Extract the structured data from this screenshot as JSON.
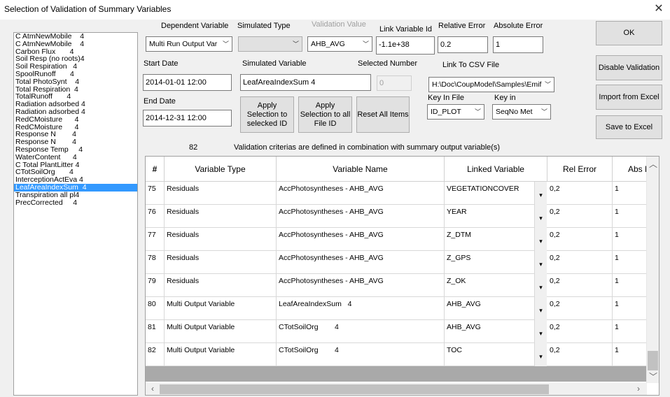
{
  "window": {
    "title": "Selection of Validation of Summary Variables",
    "close_glyph": "✕"
  },
  "list": {
    "items": [
      "C AtmNewMobile    4",
      "C AtmNewMobile    4",
      "Carbon Flux       4",
      "Soil Resp (no roots)4",
      "Soil Respiration   4",
      "SpoolRunoff       4",
      "Total PhotoSynt    4",
      "Total Respiration  4",
      "TotalRunoff       4",
      "Radiation adsorbed 4",
      "Radiation adsorbed 4",
      "RedCMoisture      4",
      "RedCMoisture      4",
      "Response N        4",
      "Response N        4",
      "Response Temp     4",
      "WaterContent      4",
      "C Total PlantLitter 4",
      "CTotSoilOrg       4",
      "InterceptionActEva 4",
      "LeafAreaIndexSum  4",
      "Transpiration all pl4",
      "PrecCorrected     4"
    ],
    "selected_index": 20
  },
  "form": {
    "dependent_variable": {
      "label": "Dependent Variable",
      "value": "Multi Run Output Var"
    },
    "simulated_type": {
      "label": "Simulated Type",
      "value": ""
    },
    "validation_value": {
      "label": "Validation Value",
      "value": "AHB_AVG"
    },
    "link_variable_id": {
      "label": "Link Variable Id",
      "value": "-1.1e+38"
    },
    "relative_error": {
      "label": "Relative Error",
      "value": "0.2"
    },
    "absolute_error": {
      "label": "Absolute Error",
      "value": "1"
    },
    "start_date": {
      "label": "Start Date",
      "value": "2014-01-01 12:00"
    },
    "end_date": {
      "label": "End Date",
      "value": "2014-12-31 12:00"
    },
    "simulated_variable": {
      "label": "Simulated Variable",
      "value": "LeafAreaIndexSum   4"
    },
    "selected_number": {
      "label": "Selected Number",
      "value": "0"
    },
    "link_csv": {
      "label": "Link To CSV File",
      "value": "H:\\Doc\\CoupModel\\Samples\\Emif"
    },
    "key_in_file": {
      "label": "Key In File",
      "value": "ID_PLOT"
    },
    "key_in": {
      "label": "Key in",
      "value": "SeqNo Met"
    }
  },
  "buttons": {
    "ok": "OK",
    "disable_validation": "Disable Validation",
    "import_excel": "Import from Excel",
    "save_excel": "Save to Excel",
    "apply_selected": "Apply Selection to selecked ID",
    "apply_all": "Apply Selection to all File ID",
    "reset_all": "Reset All Items"
  },
  "info": {
    "count": "82",
    "text": "Validation criterias are defined in combination with summary output variable(s)"
  },
  "table": {
    "headers": [
      "#",
      "Variable Type",
      "Variable Name",
      "Linked Variable",
      "Rel Error",
      "Abs E"
    ],
    "rows": [
      {
        "num": "75",
        "type": "Residuals",
        "name": "AccPhotosyntheses - AHB_AVG",
        "linked": "VEGETATIONCOVER",
        "rel": "0,2",
        "abs": "1"
      },
      {
        "num": "76",
        "type": "Residuals",
        "name": "AccPhotosyntheses - AHB_AVG",
        "linked": "YEAR",
        "rel": "0,2",
        "abs": "1"
      },
      {
        "num": "77",
        "type": "Residuals",
        "name": "AccPhotosyntheses - AHB_AVG",
        "linked": "Z_DTM",
        "rel": "0,2",
        "abs": "1"
      },
      {
        "num": "78",
        "type": "Residuals",
        "name": "AccPhotosyntheses - AHB_AVG",
        "linked": "Z_GPS",
        "rel": "0,2",
        "abs": "1"
      },
      {
        "num": "79",
        "type": "Residuals",
        "name": "AccPhotosyntheses - AHB_AVG",
        "linked": "Z_OK",
        "rel": "0,2",
        "abs": "1"
      },
      {
        "num": "80",
        "type": "Multi Output Variable",
        "name": "LeafAreaIndexSum   4",
        "linked": "AHB_AVG",
        "rel": "0,2",
        "abs": "1"
      },
      {
        "num": "81",
        "type": "Multi Output Variable",
        "name": "CTotSoilOrg        4",
        "linked": "AHB_AVG",
        "rel": "0,2",
        "abs": "1"
      },
      {
        "num": "82",
        "type": "Multi Output Variable",
        "name": "CTotSoilOrg        4",
        "linked": "TOC",
        "rel": "0,2",
        "abs": "1"
      }
    ]
  },
  "colors": {
    "selection": "#3399ff",
    "filler": "#a9a9a9"
  }
}
